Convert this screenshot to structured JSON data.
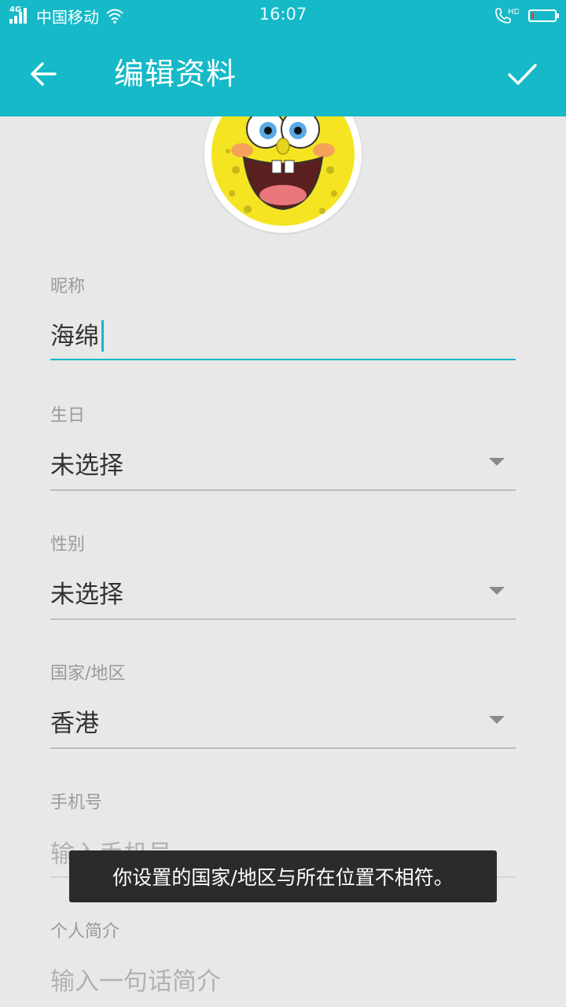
{
  "status_bar": {
    "network_type": "4G",
    "carrier": "中国移动",
    "time": "16:07",
    "hd_label": "HD",
    "battery_level": 0.1,
    "battery_color": "#e53935"
  },
  "app_bar": {
    "title": "编辑资料",
    "back_icon": "arrow-left-icon",
    "confirm_icon": "check-icon",
    "background": "#15b9c8"
  },
  "avatar": {
    "icon": "spongebob-avatar"
  },
  "form": {
    "nickname": {
      "label": "昵称",
      "value": "海绵"
    },
    "birthday": {
      "label": "生日",
      "value": "未选择"
    },
    "gender": {
      "label": "性别",
      "value": "未选择"
    },
    "region": {
      "label": "国家/地区",
      "value": "香港"
    },
    "phone": {
      "label": "手机号",
      "placeholder": "输入手机号"
    },
    "bio": {
      "label": "个人简介",
      "placeholder": "输入一句话简介"
    }
  },
  "toast": {
    "message": "你设置的国家/地区与所在位置不相符。"
  },
  "colors": {
    "accent": "#15b9c8",
    "background": "#e8e8e8",
    "toast_bg": "#2b2b2b"
  }
}
